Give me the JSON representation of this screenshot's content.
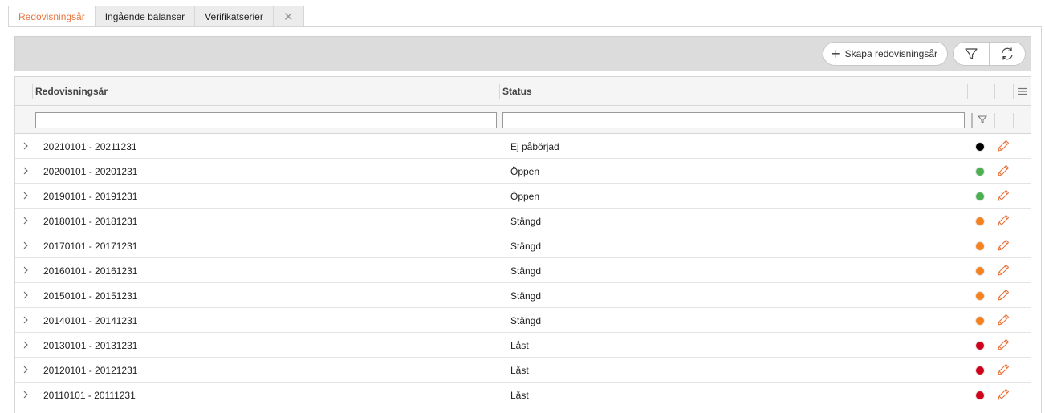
{
  "tabs": [
    {
      "label": "Redovisningsår",
      "active": true
    },
    {
      "label": "Ingående balanser",
      "active": false
    },
    {
      "label": "Verifikatserier",
      "active": false
    }
  ],
  "close_tab_icon": "close-icon",
  "toolbar": {
    "create_label": "Skapa redovisningsår",
    "create_icon": "plus-icon",
    "filter_icon": "filter-icon",
    "refresh_icon": "refresh-icon"
  },
  "grid": {
    "columns": [
      "Redovisningsår",
      "Status"
    ],
    "menu_icon": "menu-icon",
    "filter_icon": "filter-icon",
    "filters": {
      "period": "",
      "status": ""
    },
    "rows": [
      {
        "period": "20210101 - 20211231",
        "status": "Ej påbörjad",
        "color": "#000000"
      },
      {
        "period": "20200101 - 20201231",
        "status": "Öppen",
        "color": "#4caf50"
      },
      {
        "period": "20190101 - 20191231",
        "status": "Öppen",
        "color": "#4caf50"
      },
      {
        "period": "20180101 - 20181231",
        "status": "Stängd",
        "color": "#f5821f"
      },
      {
        "period": "20170101 - 20171231",
        "status": "Stängd",
        "color": "#f5821f"
      },
      {
        "period": "20160101 - 20161231",
        "status": "Stängd",
        "color": "#f5821f"
      },
      {
        "period": "20150101 - 20151231",
        "status": "Stängd",
        "color": "#f5821f"
      },
      {
        "period": "20140101 - 20141231",
        "status": "Stängd",
        "color": "#f5821f"
      },
      {
        "period": "20130101 - 20131231",
        "status": "Låst",
        "color": "#d0021b"
      },
      {
        "period": "20120101 - 20121231",
        "status": "Låst",
        "color": "#d0021b"
      },
      {
        "period": "20110101 - 20111231",
        "status": "Låst",
        "color": "#d0021b"
      }
    ]
  },
  "colors": {
    "accent": "#e8743b",
    "edit_icon": "#e8743b"
  }
}
